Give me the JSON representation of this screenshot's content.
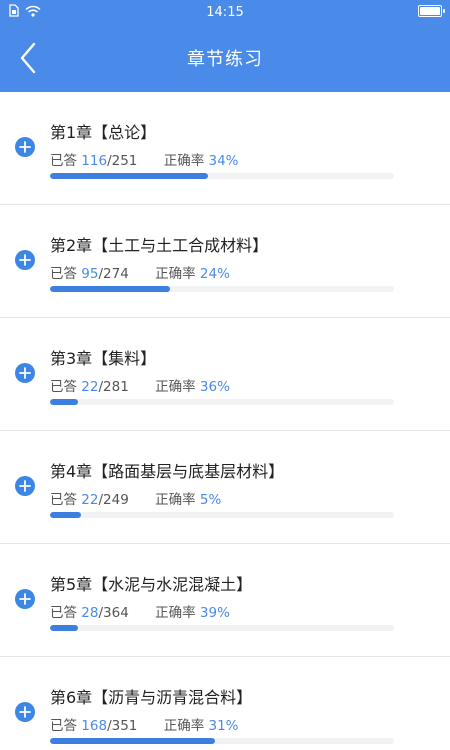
{
  "status_bar": {
    "time": "14:15",
    "battery_level": 1.0
  },
  "header": {
    "title": "章节练习"
  },
  "labels": {
    "answered": "已答",
    "accuracy": "正确率"
  },
  "chapters": [
    {
      "title": "第1章【总论】",
      "answered": "116",
      "total": "/251",
      "accuracy": "34%",
      "progress": 0.46
    },
    {
      "title": "第2章【土工与土工合成材料】",
      "answered": "95",
      "total": "/274",
      "accuracy": "24%",
      "progress": 0.35
    },
    {
      "title": "第3章【集料】",
      "answered": "22",
      "total": "/281",
      "accuracy": "36%",
      "progress": 0.08
    },
    {
      "title": "第4章【路面基层与底基层材料】",
      "answered": "22",
      "total": "/249",
      "accuracy": "5%",
      "progress": 0.09
    },
    {
      "title": "第5章【水泥与水泥混凝土】",
      "answered": "28",
      "total": "/364",
      "accuracy": "39%",
      "progress": 0.08
    },
    {
      "title": "第6章【沥青与沥青混合料】",
      "answered": "168",
      "total": "/351",
      "accuracy": "31%",
      "progress": 0.48
    }
  ],
  "colors": {
    "accent": "#4a8ae8",
    "progress": "#3d7fe0"
  }
}
